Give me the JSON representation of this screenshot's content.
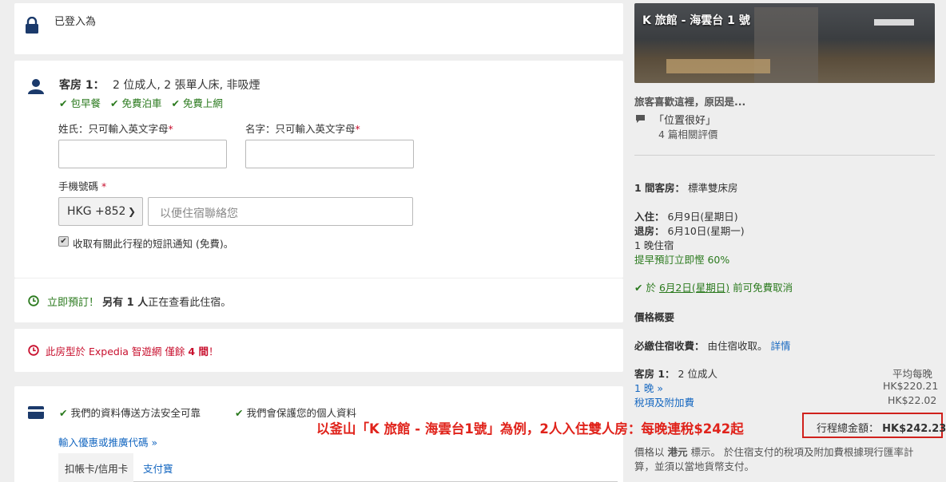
{
  "login": {
    "text": "已登入為"
  },
  "room": {
    "label": "客房 1：",
    "desc": "2 位成人, 2 張單人床, 非吸煙",
    "amenities": [
      "包早餐",
      "免費泊車",
      "免費上網"
    ],
    "surname_label": "姓氏：只可輸入英文字母",
    "givenname_label": "名字：只可輸入英文字母",
    "required_mark": "*",
    "phone_label": "手機號碼",
    "country_code": "HKG +852",
    "phone_placeholder": "以便住宿聯絡您",
    "sms_label": "收取有關此行程的短訊通知 (免費)。"
  },
  "urgent": {
    "lead": "立即預訂！",
    "bold": "另有 1 人",
    "rest": "正在查看此住宿。"
  },
  "avail": {
    "text": "此房型於 Expedia 智遊網 僅餘",
    "count": "4 間",
    "tail": "！"
  },
  "payment": {
    "secure1": "我們的資料傳送方法安全可靠",
    "secure2": "我們會保護您的個人資料",
    "promo_link": "輸入優惠或推廣代碼",
    "tabs": [
      "扣帳卡/信用卡",
      "支付寶"
    ]
  },
  "sidebar": {
    "hotel_name": "K 旅館 - 海雲台 1 號",
    "why_title": "旅客喜歡這裡，原因是...",
    "review_quote": "「位置很好」",
    "review_count": "4 篇相關評價",
    "rooms_label": "1 間客房：",
    "rooms_value": "標準雙床房",
    "checkin_label": "入住：",
    "checkin_value": "6月9日(星期日)",
    "checkout_label": "退房：",
    "checkout_value": "6月10日(星期一)",
    "nights": "1 晚住宿",
    "early_discount": "提早預訂立即慳 60%",
    "cancel_pre": "於",
    "cancel_date": "6月2日(星期日)",
    "cancel_post": "前可免費取消",
    "price_overview": "價格概要",
    "mandatory_label": "必繳住宿收費：",
    "mandatory_value": "由住宿收取。",
    "details_link": "詳情",
    "room1_label": "客房 1：",
    "room1_value": "2 位成人",
    "avg_nightly": "平均每晚",
    "one_night": "1 晚",
    "one_night_price": "HK$220.21",
    "tax_label": "稅項及附加費",
    "tax_price": "HK$22.02",
    "total_label": "行程總金額：",
    "total_price": "HK$242.23",
    "footnote1_pre": "價格以",
    "footnote1_bold": "港元",
    "footnote1_post": "標示。 於住宿支付的稅項及附加費根據現行匯率計",
    "footnote2": "算，並須以當地貨幣支付。"
  },
  "annotation": "以釜山「K 旅館 - 海雲台1號」為例，2人入住雙人房：每晚連稅$242起",
  "colors": {
    "green": "#2b7a1e",
    "red": "#c8102e",
    "blue": "#1668c1",
    "annotation": "#e0231b",
    "icon": "#1b3a6b"
  }
}
